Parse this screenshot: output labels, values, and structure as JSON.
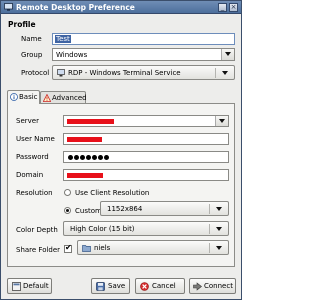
{
  "window": {
    "title": "Remote Desktop Preference",
    "title_icon": "remote-desktop-icon",
    "buttons": {
      "minimize": "_",
      "close": "×"
    }
  },
  "profile": {
    "heading": "Profile",
    "name_label": "Name",
    "name_value": "Test",
    "group_label": "Group",
    "group_value": "Windows",
    "protocol_label": "Protocol",
    "protocol_value": "RDP - Windows Terminal Service",
    "protocol_icon": "rdp-icon"
  },
  "tabs": [
    {
      "label": "Basic",
      "icon": "info-icon",
      "active": true
    },
    {
      "label": "Advanced",
      "icon": "warning-icon",
      "active": false
    }
  ],
  "basic": {
    "server_label": "Server",
    "username_label": "User Name",
    "password_label": "Password",
    "domain_label": "Domain",
    "resolution_label": "Resolution",
    "resolution_client": "Use Client Resolution",
    "resolution_custom": "Custom",
    "resolution_value": "1152x864",
    "color_depth_label": "Color Depth",
    "color_depth_value": "High Color (15 bit)",
    "share_folder_label": "Share Folder",
    "share_folder_value": "niels",
    "share_folder_checked": true
  },
  "footer": {
    "default_label": "Default",
    "save_label": "Save",
    "cancel_label": "Cancel",
    "connect_label": "Connect"
  },
  "colors": {
    "titlebar": "#5b7aa6",
    "redaction": "#e8101a",
    "window_bg": "#ededeb",
    "selection": "#3f64a3"
  }
}
